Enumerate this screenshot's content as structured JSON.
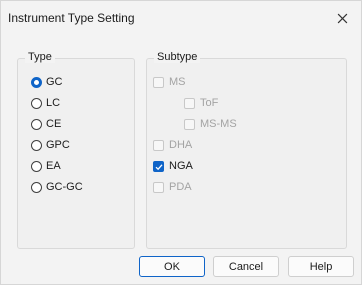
{
  "window": {
    "title": "Instrument Type Setting"
  },
  "type_group": {
    "label": "Type",
    "options": [
      {
        "label": "GC",
        "selected": true
      },
      {
        "label": "LC",
        "selected": false
      },
      {
        "label": "CE",
        "selected": false
      },
      {
        "label": "GPC",
        "selected": false
      },
      {
        "label": "EA",
        "selected": false
      },
      {
        "label": "GC-GC",
        "selected": false
      }
    ]
  },
  "subtype_group": {
    "label": "Subtype",
    "options": [
      {
        "label": "MS",
        "checked": false,
        "enabled": false
      },
      {
        "label": "ToF",
        "checked": false,
        "enabled": false
      },
      {
        "label": "MS-MS",
        "checked": false,
        "enabled": false
      },
      {
        "label": "DHA",
        "checked": false,
        "enabled": false
      },
      {
        "label": "NGA",
        "checked": true,
        "enabled": true
      },
      {
        "label": "PDA",
        "checked": false,
        "enabled": false
      }
    ]
  },
  "buttons": {
    "ok": "OK",
    "cancel": "Cancel",
    "help": "Help"
  },
  "colors": {
    "accent": "#0f64c8",
    "disabled_text": "#a3a3a3"
  }
}
